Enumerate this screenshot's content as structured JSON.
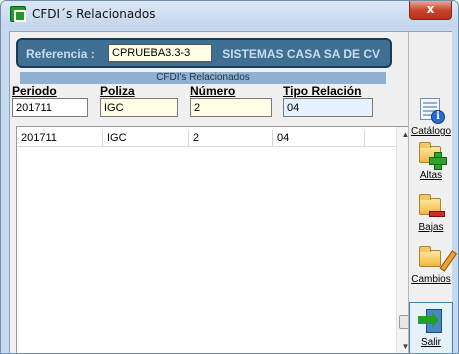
{
  "window": {
    "title": "CFDI´s Relacionados",
    "close_glyph": "x"
  },
  "reference": {
    "label": "Referencia :",
    "value": "CPRUEBA3.3-3",
    "company": "SISTEMAS CASA SA DE CV"
  },
  "section": {
    "title": "CFDI's Relacionados"
  },
  "fields": {
    "periodo": {
      "label": "Periodo",
      "value": "201711"
    },
    "poliza": {
      "label": "Poliza",
      "value": "IGC"
    },
    "numero": {
      "label": "Número",
      "value": "2"
    },
    "tipo_relacion": {
      "label": "Tipo Relación",
      "value": "04"
    }
  },
  "grid": {
    "rows": [
      {
        "periodo": "201711",
        "poliza": "IGC",
        "numero": "2",
        "tipo_relacion": "04"
      }
    ]
  },
  "toolbar": {
    "catalogo": {
      "label": "Catálogo",
      "icon": "catalog-info-icon"
    },
    "altas": {
      "label": "Altas",
      "icon": "folder-add-icon"
    },
    "bajas": {
      "label": "Bajas",
      "icon": "folder-remove-icon"
    },
    "cambios": {
      "label": "Cambios",
      "icon": "folder-edit-icon"
    },
    "salir": {
      "label": "Salir",
      "icon": "exit-door-icon"
    }
  },
  "colors": {
    "title_bar": "#c3d6ec",
    "reference_panel": "#3f6f93",
    "section_bar": "#8fb1d3",
    "input_yellow": "#ffffe6",
    "input_blue": "#e6f2ff",
    "close_button": "#c9452e"
  }
}
